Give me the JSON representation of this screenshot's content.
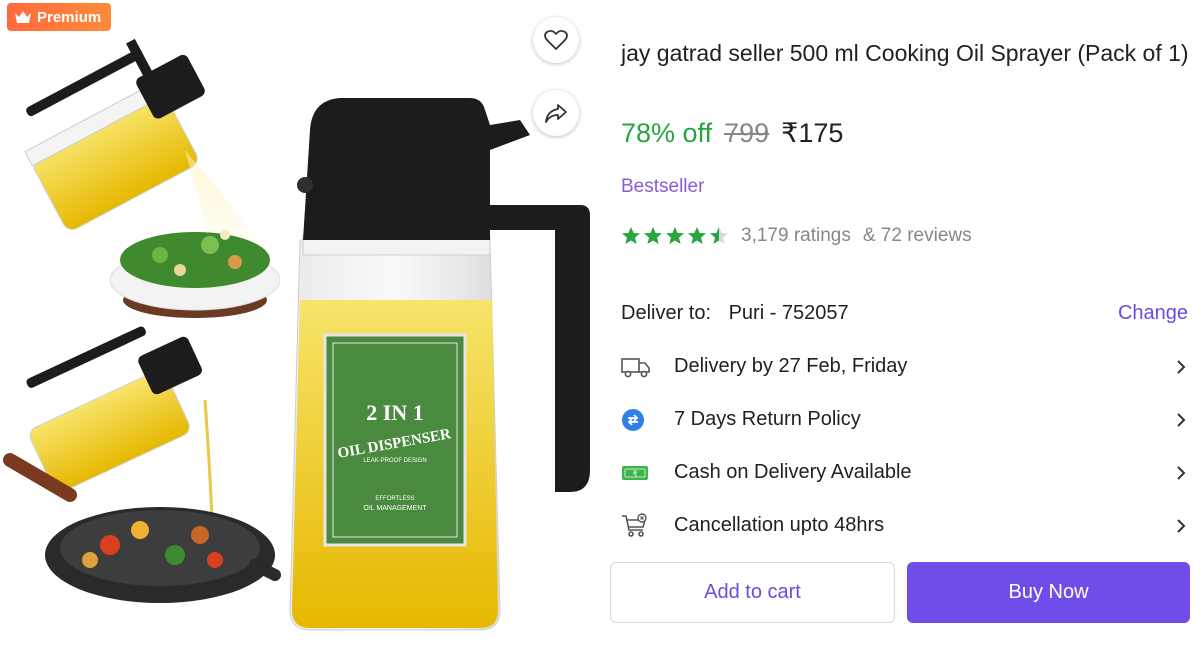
{
  "badge": {
    "label": "Premium",
    "icon": "crown-icon",
    "color": "#ff6a3d"
  },
  "image": {
    "label_top": "2 IN 1",
    "label_main": "OIL DISPENSER",
    "label_sub": "LEAK-PROOF DESIGN",
    "label_foot": "EFFORTLESS",
    "label_foot2": "OIL MANAGEMENT"
  },
  "product": {
    "title": "jay gatrad seller 500 ml Cooking Oil Sprayer (Pack of 1)",
    "discount": "78% off",
    "mrp": "799",
    "price": "₹175",
    "tag": "Bestseller",
    "rating_stars": 4.5,
    "ratings": "3,179 ratings",
    "reviews": "& 72 reviews"
  },
  "delivery": {
    "label": "Deliver to:",
    "location": "Puri - 752057",
    "change": "Change"
  },
  "info": [
    {
      "icon": "truck-icon",
      "label": "Delivery by 27 Feb, Friday"
    },
    {
      "icon": "return-icon",
      "label": "7 Days Return Policy"
    },
    {
      "icon": "cash-icon",
      "label": "Cash on Delivery Available"
    },
    {
      "icon": "cart-cancel-icon",
      "label": "Cancellation upto 48hrs"
    }
  ],
  "actions": {
    "add_to_cart": "Add to cart",
    "buy_now": "Buy Now"
  },
  "colors": {
    "green": "#26a541",
    "accent": "#6e4de8",
    "bestseller": "#8a5cd6"
  }
}
